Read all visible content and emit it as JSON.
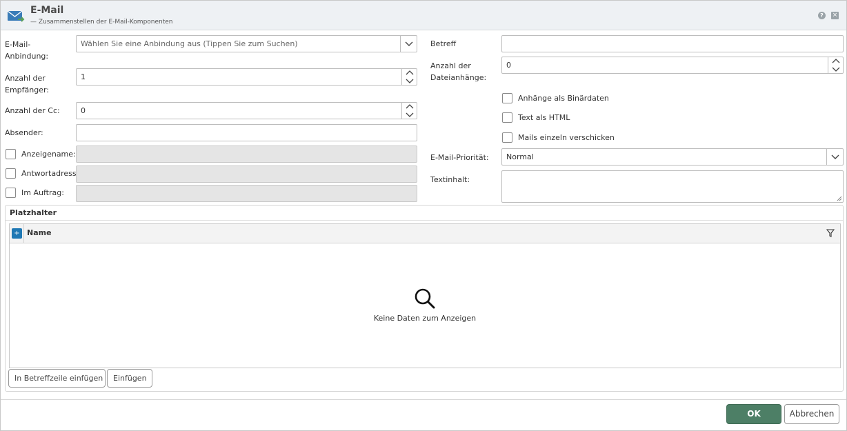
{
  "header": {
    "title": "E-Mail",
    "subtitle": "— Zusammenstellen der E-Mail-Komponenten",
    "help_icon": "?",
    "close_icon": "×"
  },
  "left": {
    "connection_label": "E-Mail-\nAnbindung:",
    "connection_label_line1": "E-Mail-",
    "connection_label_line2": "Anbindung:",
    "connection_placeholder": "Wählen Sie eine Anbindung aus (Tippen Sie zum Suchen)",
    "recipients_label_line1": "Anzahl der",
    "recipients_label_line2": "Empfänger:",
    "recipients_value": "1",
    "cc_label": "Anzahl der Cc:",
    "cc_value": "0",
    "sender_label": "Absender:",
    "sender_value": "",
    "display_name_label": "Anzeigename:",
    "reply_to_label": "Antwortadresse:",
    "on_behalf_label": "Im Auftrag:"
  },
  "right": {
    "subject_label": "Betreff",
    "subject_value": "",
    "attachments_label_line1": "Anzahl der",
    "attachments_label_line2": "Dateianhänge:",
    "attachments_value": "0",
    "binary_attachments_label": "Anhänge als Binärdaten",
    "text_html_label": "Text als HTML",
    "send_individually_label": "Mails einzeln verschicken",
    "priority_label": "E-Mail-Priorität:",
    "priority_value": "Normal",
    "body_label": "Textinhalt:"
  },
  "placeholders": {
    "title": "Platzhalter",
    "column_name": "Name",
    "add_icon": "+",
    "empty_text": "Keine Daten zum Anzeigen",
    "insert_subject_button": "In Betreffzeile einfügen",
    "insert_button": "Einfügen"
  },
  "footer": {
    "ok_label": "OK",
    "cancel_label": "Abbrechen"
  },
  "colors": {
    "accent": "#1f78b4",
    "ok_button": "#4d7f66"
  }
}
